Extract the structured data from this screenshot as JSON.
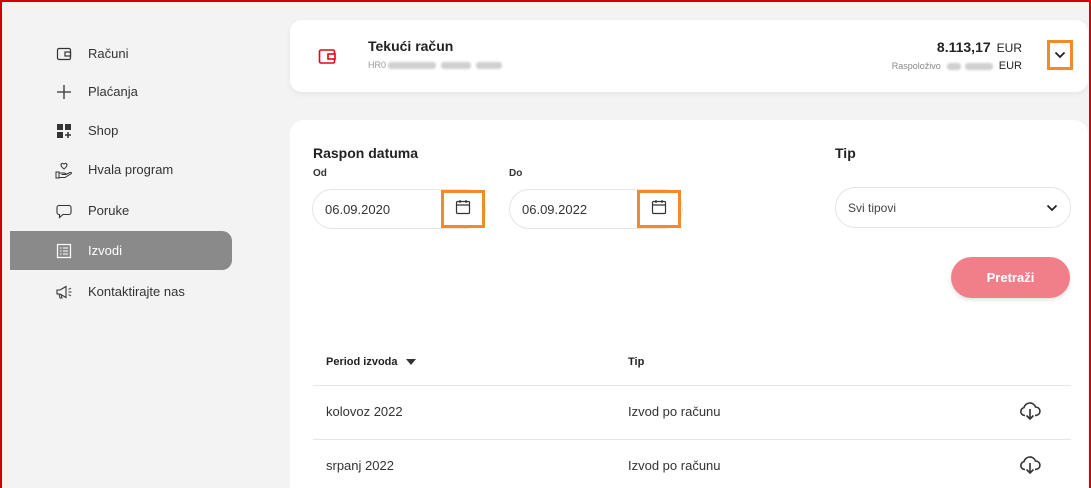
{
  "sidebar": {
    "items": [
      {
        "label": "Računi",
        "icon": "wallet-icon"
      },
      {
        "label": "Plaćanja",
        "icon": "plus-icon"
      },
      {
        "label": "Shop",
        "icon": "shop-grid-icon"
      },
      {
        "label": "Hvala program",
        "icon": "heart-hand-icon"
      },
      {
        "label": "Poruke",
        "icon": "chat-icon"
      },
      {
        "label": "Izvodi",
        "icon": "statement-icon"
      },
      {
        "label": "Kontaktirajte nas",
        "icon": "megaphone-icon"
      }
    ],
    "active_index": 5
  },
  "account": {
    "title": "Tekući račun",
    "iban_prefix": "HR0",
    "balance": "8.113,17",
    "currency": "EUR",
    "available_label": "Raspoloživo",
    "available_currency": "EUR"
  },
  "filters": {
    "date_range_label": "Raspon datuma",
    "from_label": "Od",
    "from_value": "06.09.2020",
    "to_label": "Do",
    "to_value": "06.09.2022",
    "type_label": "Tip",
    "type_value": "Svi tipovi",
    "search_label": "Pretraži"
  },
  "table": {
    "headers": [
      "Period izvoda",
      "Tip"
    ],
    "rows": [
      {
        "period": "kolovoz 2022",
        "type": "Izvod po računu"
      },
      {
        "period": "srpanj 2022",
        "type": "Izvod po računu"
      }
    ]
  },
  "colors": {
    "highlight": "#f08a2b",
    "brand_red": "#e30613",
    "button": "#f07f8a",
    "active_nav": "#8a8a8a"
  }
}
